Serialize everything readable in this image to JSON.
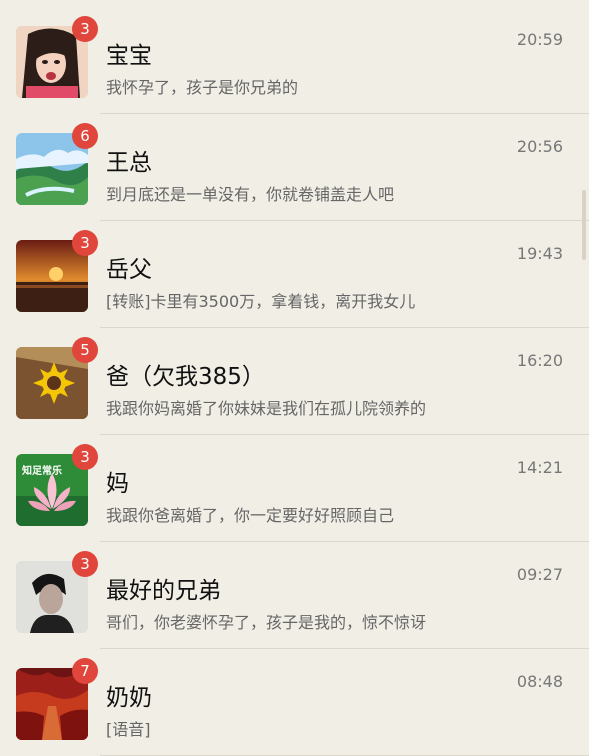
{
  "chats": [
    {
      "name": "宝宝",
      "message": "我怀孕了，孩子是你兄弟的",
      "time": "20:59",
      "badge": "3",
      "avatar_icon": "woman-photo-icon"
    },
    {
      "name": "王总",
      "message": "到月底还是一单没有，你就卷铺盖走人吧",
      "time": "20:56",
      "badge": "6",
      "avatar_icon": "landscape-photo-icon"
    },
    {
      "name": "岳父",
      "message": "[转账]卡里有3500万，拿着钱，离开我女儿",
      "time": "19:43",
      "badge": "3",
      "avatar_icon": "sunset-photo-icon"
    },
    {
      "name": "爸（欠我385）",
      "message": "我跟你妈离婚了你妹妹是我们在孤儿院领养的",
      "time": "16:20",
      "badge": "5",
      "avatar_icon": "sunflower-photo-icon"
    },
    {
      "name": "妈",
      "message": "我跟你爸离婚了，你一定要好好照顾自己",
      "time": "14:21",
      "badge": "3",
      "avatar_icon": "lotus-photo-icon",
      "avatar_text": "知足常乐"
    },
    {
      "name": "最好的兄弟",
      "message": "哥们，你老婆怀孕了，孩子是我的，惊不惊讶",
      "time": "09:27",
      "badge": "3",
      "avatar_icon": "man-portrait-icon"
    },
    {
      "name": "奶奶",
      "message": "[语音]",
      "time": "08:48",
      "badge": "7",
      "avatar_icon": "autumn-path-icon"
    }
  ],
  "colors": {
    "background": "#f1eee6",
    "badge": "#e0463b",
    "name": "#111111",
    "message": "#666666",
    "time": "#777777"
  }
}
